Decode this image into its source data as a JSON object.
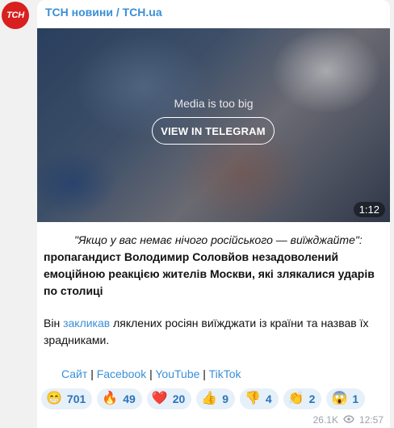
{
  "channel": {
    "avatar_text": "ТСН",
    "name": "ТСН новини / TCH.ua"
  },
  "media": {
    "message": "Media is too big",
    "button_label": "VIEW IN TELEGRAM",
    "duration": "1:12"
  },
  "post": {
    "quote": "\"Якщо у вас немає нічого російського — виїжджайте\":",
    "quote_rest": " пропагандист Володимир Соловйов незадоволений емоційною реакцією жителів Москви, які злякалися ударів по столиці",
    "p2_pre": "Він ",
    "p2_link": "закликав",
    "p2_post": " ляклених росіян виїжджати із країни та назвав їх зрадниками."
  },
  "links": [
    "Сайт",
    "Facebook",
    "YouTube",
    "TikTok"
  ],
  "link_separator": "|",
  "reactions": [
    {
      "emoji": "😁",
      "count": "701"
    },
    {
      "emoji": "🔥",
      "count": "49"
    },
    {
      "emoji": "❤️",
      "count": "20"
    },
    {
      "emoji": "👍",
      "count": "9"
    },
    {
      "emoji": "👎",
      "count": "4"
    },
    {
      "emoji": "👏",
      "count": "2"
    },
    {
      "emoji": "😱",
      "count": "1"
    }
  ],
  "meta": {
    "views": "26.1K",
    "views_icon": "eye-icon",
    "time": "12:57"
  }
}
